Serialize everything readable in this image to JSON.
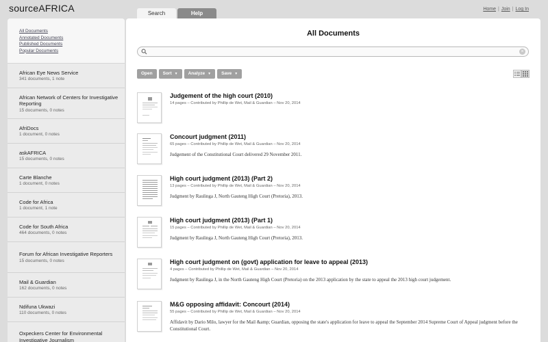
{
  "header": {
    "logo": "sourceAFRICA",
    "tabs": [
      {
        "label": "Search"
      },
      {
        "label": "Help"
      }
    ],
    "links": [
      "Home",
      "Join",
      "Log In"
    ],
    "separator": "|"
  },
  "sidebar": {
    "links": [
      "All Documents",
      "Annotated Documents",
      "Published Documents",
      "Popular Documents"
    ],
    "orgs": [
      {
        "name": "African Eye News Service",
        "meta": "341 documents, 1 note"
      },
      {
        "name": "African Network of Centers for Investigative Reporting",
        "meta": "15 documents, 0 notes"
      },
      {
        "name": "AfriDocs",
        "meta": "1 document, 0 notes"
      },
      {
        "name": "askAFRICA",
        "meta": "15 documents, 0 notes"
      },
      {
        "name": "Carte Blanche",
        "meta": "1 document, 0 notes"
      },
      {
        "name": "Code for Africa",
        "meta": "1 document, 1 note"
      },
      {
        "name": "Code for South Africa",
        "meta": "464 documents, 0 notes"
      },
      {
        "name": "Forum for African Investigative Reporters",
        "meta": "15 documents, 0 notes"
      },
      {
        "name": "Mail & Guardian",
        "meta": "162 documents, 0 notes"
      },
      {
        "name": "Ndifuna Ukwazi",
        "meta": "110 documents, 0 notes"
      },
      {
        "name": "Oxpeckers Center for Environmental Investigative Journalism",
        "meta": ""
      }
    ]
  },
  "main": {
    "title": "All Documents",
    "search": {
      "value": "",
      "placeholder": ""
    },
    "toolbar": {
      "open": "Open",
      "sort": "Sort",
      "analyze": "Analyze",
      "save": "Save"
    },
    "documents": [
      {
        "title": "Judgement of the high court (2010)",
        "meta": "14 pages – Contributed by Phillip de Wet, Mail & Guardian – Nov 20, 2014",
        "desc": ""
      },
      {
        "title": "Concourt judgment (2011)",
        "meta": "65 pages – Contributed by Phillip de Wet, Mail & Guardian – Nov 20, 2014",
        "desc": "Judgement of the Constitutional Court delivered 29 November 2011."
      },
      {
        "title": "High court judgment (2013) (Part 2)",
        "meta": "13 pages – Contributed by Phillip de Wet, Mail & Guardian – Nov 20, 2014",
        "desc": "Judgment by Raulinga J, North Gauteng High Court (Pretoria), 2013."
      },
      {
        "title": "High court judgment (2013) (Part 1)",
        "meta": "15 pages – Contributed by Phillip de Wet, Mail & Guardian – Nov 20, 2014",
        "desc": "Judgment by Raulinga J, North Gauteng High Court (Pretoria), 2013."
      },
      {
        "title": "High court judgment on (govt) application for leave to appeal (2013)",
        "meta": "4 pages – Contributed by Phillip de Wet, Mail & Guardian – Nov 20, 2014",
        "desc": "Judgment by Raulinga J, in the North Gauteng High Court (Pretoria) on the 2013 application by the state to appeal the 2013 high court judgement."
      },
      {
        "title": "M&G opposing affidavit: Concourt (2014)",
        "meta": "55 pages – Contributed by Phillip de Wet, Mail & Guardian – Nov 20, 2014",
        "desc": "Affidavit by Dario Milo, lawyer for the Mail &amp; Guardian, opposing the state's application for leave to appeal the September 2014 Supreme Court of Appeal judgment before the Constitutional Court."
      }
    ]
  }
}
